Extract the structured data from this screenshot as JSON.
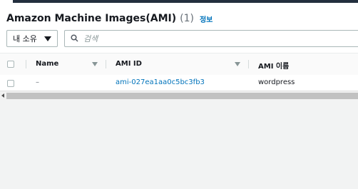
{
  "header": {
    "title": "Amazon Machine Images(AMI)",
    "count": "(1)",
    "info": "정보"
  },
  "filter": {
    "dropdown_label": "내 소유"
  },
  "search": {
    "placeholder": "검색"
  },
  "table": {
    "columns": [
      "Name",
      "AMI ID",
      "AMI 이름"
    ],
    "rows": [
      {
        "name": "–",
        "ami_id": "ami-027ea1aa0c5bc3fb3",
        "ami_name": "wordpress"
      }
    ]
  },
  "colors": {
    "link": "#0073bb",
    "topbar": "#232f3e",
    "background": "#f2f3f3"
  }
}
